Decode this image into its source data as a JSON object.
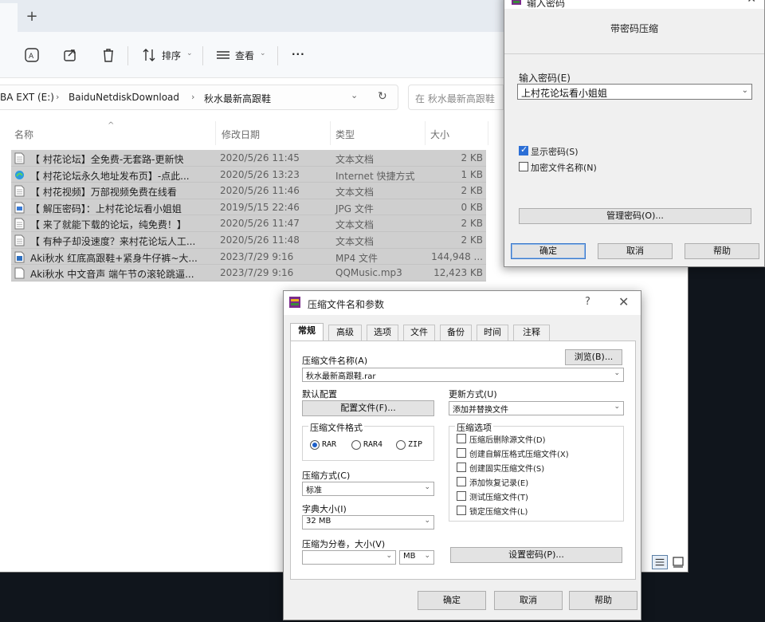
{
  "explorer": {
    "newtab_symbol": "+",
    "toolbar": {
      "sort_label": "排序",
      "view_label": "查看",
      "more_label": "···"
    },
    "breadcrumb": [
      "BA EXT (E:)",
      "BaiduNetdiskDownload",
      "秋水最新高跟鞋"
    ],
    "search_placeholder": "在 秋水最新高跟鞋",
    "columns": {
      "name": "名称",
      "date": "修改日期",
      "type": "类型",
      "size": "大小"
    },
    "files": [
      {
        "icon": "text-file-icon",
        "name": "【 村花论坛】全免费-无套路-更新快",
        "date": "2020/5/26 11:45",
        "type": "文本文档",
        "size": "2 KB"
      },
      {
        "icon": "edge-shortcut-icon",
        "name": "【 村花论坛永久地址发布页】-点此...",
        "date": "2020/5/26 13:23",
        "type": "Internet 快捷方式",
        "size": "1 KB"
      },
      {
        "icon": "text-file-icon",
        "name": "【 村花视频】万部视频免费在线看",
        "date": "2020/5/26 11:46",
        "type": "文本文档",
        "size": "2 KB"
      },
      {
        "icon": "jpg-file-icon",
        "name": "【 解压密码】：上村花论坛看小姐姐",
        "date": "2019/5/15 22:46",
        "type": "JPG 文件",
        "size": "0 KB"
      },
      {
        "icon": "text-file-icon",
        "name": "【 来了就能下载的论坛，纯免费！】",
        "date": "2020/5/26 11:47",
        "type": "文本文档",
        "size": "2 KB"
      },
      {
        "icon": "text-file-icon",
        "name": "【 有种子却没速度？来村花论坛人工...",
        "date": "2020/5/26 11:48",
        "type": "文本文档",
        "size": "2 KB"
      },
      {
        "icon": "mp4-file-icon",
        "name": "Aki秋水 红底高跟鞋+紧身牛仔裤~大...",
        "date": "2023/7/29 9:16",
        "type": "MP4 文件",
        "size": "144,948 ..."
      },
      {
        "icon": "mp3-file-icon",
        "name": "Aki秋水 中文音声 端午节の滚轮跳逼...",
        "date": "2023/7/29 9:16",
        "type": "QQMusic.mp3",
        "size": "12,423 KB"
      }
    ]
  },
  "password_dialog": {
    "title": "输入密码",
    "heading": "带密码压缩",
    "password_label": "输入密码(E)",
    "password_value": "上村花论坛看小姐姐",
    "show_password_label": "显示密码(S)",
    "show_password_checked": true,
    "encrypt_names_label": "加密文件名称(N)",
    "encrypt_names_checked": false,
    "manage_button": "管理密码(O)...",
    "ok_button": "确定",
    "cancel_button": "取消",
    "help_button": "帮助"
  },
  "archive_dialog": {
    "title": "压缩文件名和参数",
    "help_symbol": "?",
    "close_symbol": "✕",
    "tabs": [
      "常规",
      "高级",
      "选项",
      "文件",
      "备份",
      "时间",
      "注释"
    ],
    "active_tab": "常规",
    "archive_name_label": "压缩文件名称(A)",
    "browse_button": "浏览(B)...",
    "archive_name_value": "秋水最新高跟鞋.rar",
    "default_profile_label": "默认配置",
    "profiles_button": "配置文件(F)...",
    "update_mode_label": "更新方式(U)",
    "update_mode_value": "添加并替换文件",
    "format_group_label": "压缩文件格式",
    "formats": [
      "RAR",
      "RAR4",
      "ZIP"
    ],
    "selected_format": "RAR",
    "options_group_label": "压缩选项",
    "options": [
      {
        "label": "压缩后删除源文件(D)",
        "checked": false
      },
      {
        "label": "创建自解压格式压缩文件(X)",
        "checked": false
      },
      {
        "label": "创建固实压缩文件(S)",
        "checked": false
      },
      {
        "label": "添加恢复记录(E)",
        "checked": false
      },
      {
        "label": "测试压缩文件(T)",
        "checked": false
      },
      {
        "label": "锁定压缩文件(L)",
        "checked": false
      }
    ],
    "method_label": "压缩方式(C)",
    "method_value": "标准",
    "dict_label": "字典大小(I)",
    "dict_value": "32 MB",
    "split_label": "压缩为分卷，大小(V)",
    "split_value": "",
    "split_unit": "MB",
    "set_password_button": "设置密码(P)...",
    "ok_button": "确定",
    "cancel_button": "取消",
    "help_button": "帮助"
  }
}
